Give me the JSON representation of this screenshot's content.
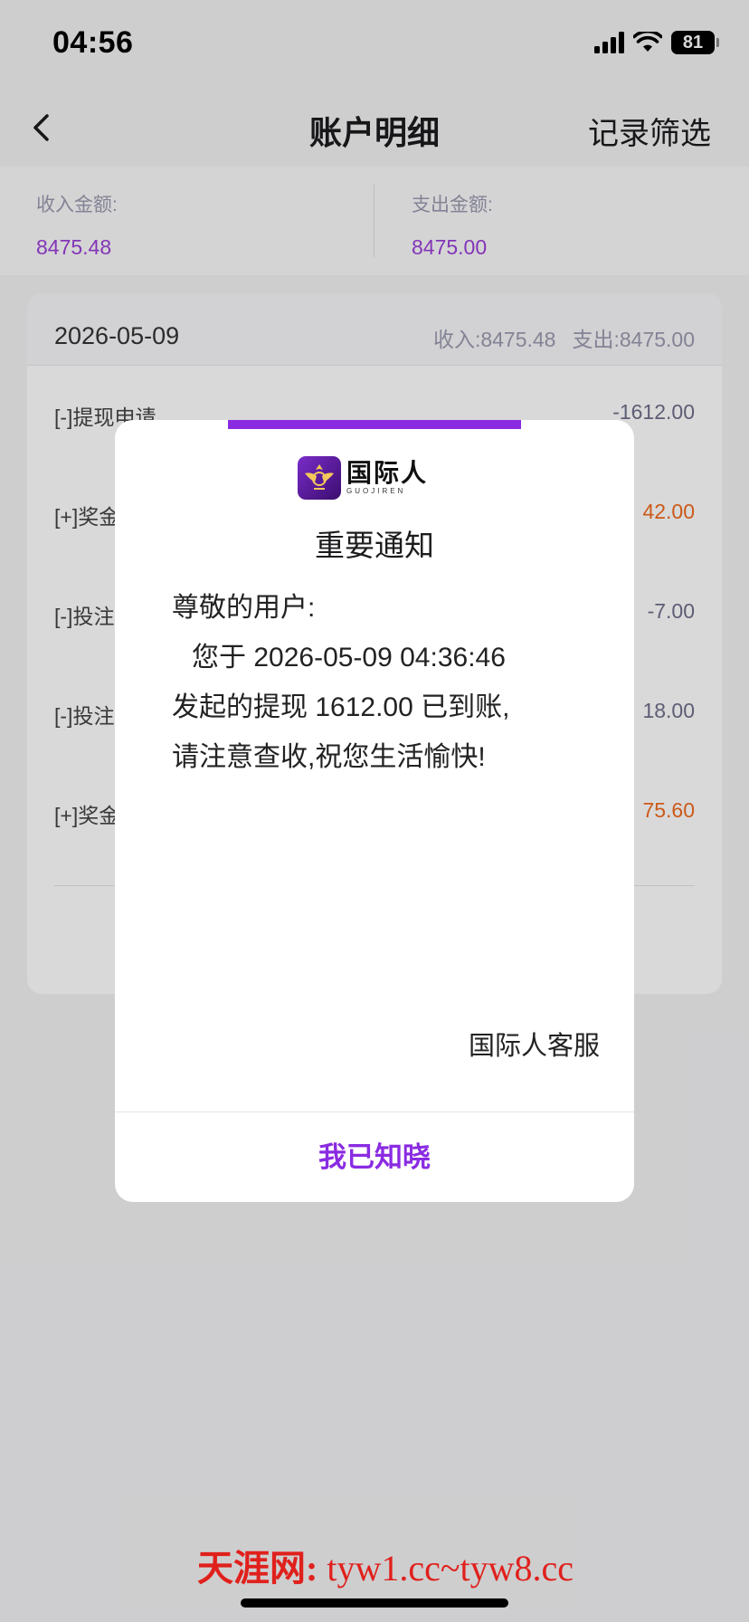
{
  "status_bar": {
    "time": "04:56",
    "battery": "81"
  },
  "nav": {
    "title": "账户明细",
    "filter_label": "记录筛选"
  },
  "summary": {
    "income_label": "收入金额:",
    "income_value": "8475.48",
    "expense_label": "支出金额:",
    "expense_value": "8475.00"
  },
  "card": {
    "date": "2026-05-09",
    "total_income": "收入:8475.48",
    "total_expense": "支出:8475.00",
    "rows": [
      {
        "title": "[-]提现申请",
        "amount": "-1612.00"
      },
      {
        "title": "[+]奖金",
        "amount": "42.00"
      },
      {
        "title": "[-]投注",
        "amount": "-7.00"
      },
      {
        "title": "[-]投注",
        "amount": "18.00"
      },
      {
        "title": "[+]奖金",
        "amount": "75.60"
      }
    ]
  },
  "modal": {
    "logo_cn": "国际人",
    "logo_en": "GUOJIREN",
    "title": "重要通知",
    "lines": [
      "尊敬的用户:",
      "您于 2026-05-09 04:36:46",
      "发起的提现 1612.00 已到账,",
      "请注意查收,祝您生活愉快!"
    ],
    "signature": "国际人客服",
    "button_label": "我已知晓"
  },
  "watermark": {
    "cn": "天涯网:",
    "url": "tyw1.cc~tyw8.cc"
  },
  "colors": {
    "accent": "#8a2be2",
    "income": "#9b3fd6",
    "positive": "#ef6a1f",
    "negative": "#6e6e8a"
  }
}
